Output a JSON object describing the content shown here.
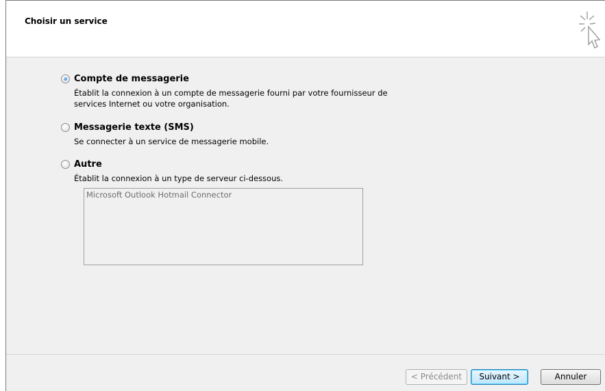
{
  "header": {
    "title": "Choisir un service",
    "icon": "wizard-cursor-icon"
  },
  "options": [
    {
      "label": "Compte de messagerie",
      "description": "Établit la connexion à un compte de messagerie fourni par votre fournisseur de services Internet ou votre organisation.",
      "selected": true
    },
    {
      "label": "Messagerie texte (SMS)",
      "description": "Se connecter à un service de messagerie mobile.",
      "selected": false
    },
    {
      "label": "Autre",
      "description": "Établit la connexion à un type de serveur ci-dessous.",
      "selected": false
    }
  ],
  "server_list": {
    "items": [
      "Microsoft Outlook Hotmail Connector"
    ]
  },
  "footer": {
    "prev_label": "< Précédent",
    "next_label": "Suivant >",
    "cancel_label": "Annuler"
  },
  "colors": {
    "content_bg": "#f0f0f0",
    "accent": "#1c6fbf"
  }
}
